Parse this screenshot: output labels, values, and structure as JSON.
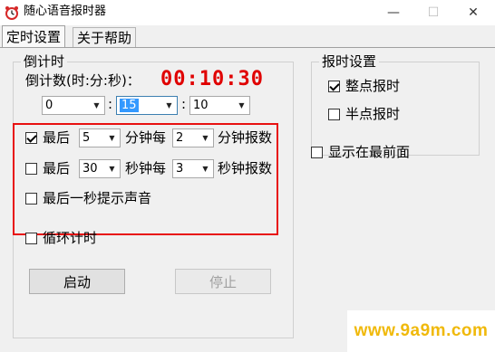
{
  "window": {
    "title": "随心语音报时器",
    "min_symbol": "—",
    "max_symbol": "☐",
    "close_symbol": "✕",
    "icon": "alarm-clock-icon"
  },
  "tabs": [
    {
      "label": "定时设置",
      "active": true
    },
    {
      "label": "关于帮助",
      "active": false
    }
  ],
  "countdown": {
    "group_label": "倒计时",
    "prompt": "倒计数(时:分:秒)：",
    "display": "00:10:30",
    "hours": "0",
    "minutes": "15",
    "seconds": "10",
    "colon": ":"
  },
  "rules": {
    "rule1": {
      "checked": true,
      "prefix": "最后",
      "amount": "5",
      "mid": "分钟每",
      "interval": "2",
      "suffix": "分钟报数"
    },
    "rule2": {
      "checked": false,
      "prefix": "最后",
      "amount": "30",
      "mid": "秒钟每",
      "interval": "3",
      "suffix": "秒钟报数"
    },
    "rule3": {
      "checked": false,
      "label": "最后一秒提示声音"
    }
  },
  "loop": {
    "checked": false,
    "label": "循环计时"
  },
  "buttons": {
    "start": "启动",
    "stop": "停止"
  },
  "report": {
    "group_label": "报时设置",
    "on_hour": {
      "checked": true,
      "label": "整点报时"
    },
    "half_hour": {
      "checked": false,
      "label": "半点报时"
    }
  },
  "topmost": {
    "checked": false,
    "label": "显示在最前面"
  },
  "watermark": "www.9a9m.com",
  "colors": {
    "accent_red": "#e00000",
    "highlight": "#3399ff",
    "watermark": "#f0b90b"
  }
}
